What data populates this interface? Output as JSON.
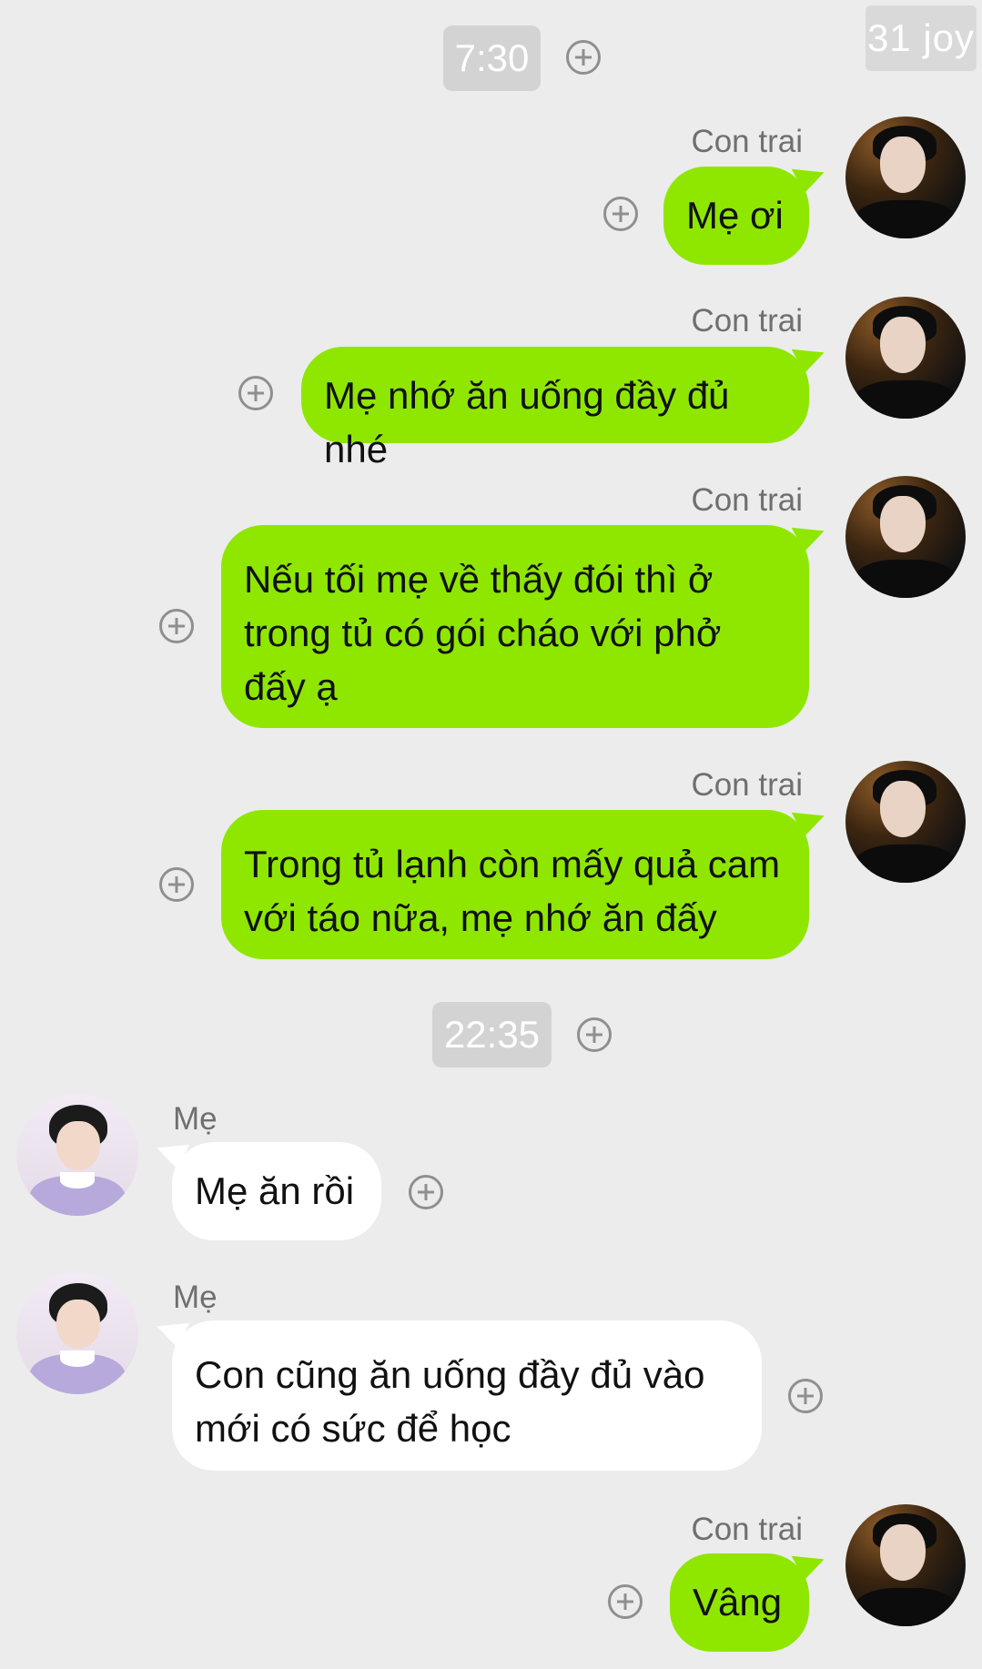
{
  "watermark": "31 joy",
  "times": [
    "7:30",
    "22:35"
  ],
  "messages": [
    {
      "sender": "Con trai",
      "text": "Mẹ ơi"
    },
    {
      "sender": "Con trai",
      "text": "Mẹ nhớ ăn uống đầy đủ nhé"
    },
    {
      "sender": "Con trai",
      "text": "Nếu tối mẹ về thấy đói thì ở trong tủ có gói cháo với phở đấy ạ"
    },
    {
      "sender": "Con trai",
      "text": "Trong tủ lạnh còn mấy quả cam với táo nữa, mẹ nhớ ăn đấy"
    },
    {
      "sender": "Mẹ",
      "text": "Mẹ ăn rồi"
    },
    {
      "sender": "Mẹ",
      "text": "Con cũng ăn uống đầy đủ vào mới có sức để học"
    },
    {
      "sender": "Con trai",
      "text": "Vâng"
    }
  ],
  "icons": {
    "add": "plus-circle-icon"
  },
  "colors": {
    "sent_bubble": "#8fe700",
    "received_bubble": "#ffffff",
    "background": "#ececec"
  }
}
